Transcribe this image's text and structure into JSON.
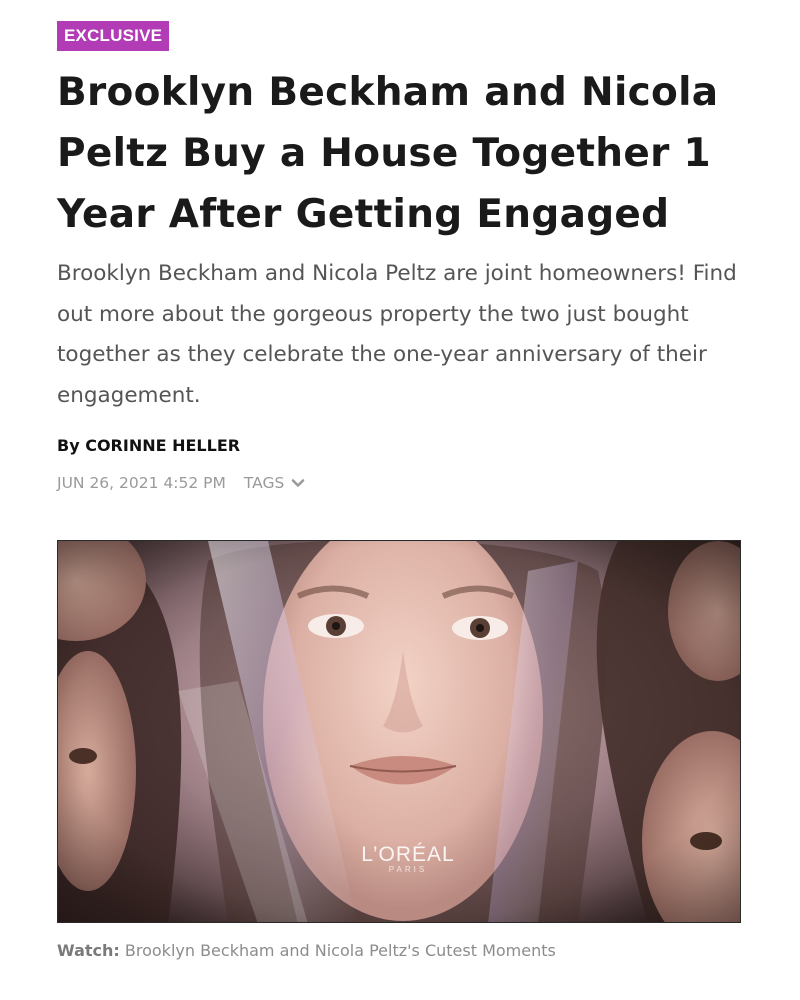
{
  "article": {
    "badge": "EXCLUSIVE",
    "headline": "Brooklyn Beckham and Nicola Peltz Buy a House Together 1 Year After Getting Engaged",
    "dek": "Brooklyn Beckham and Nicola Peltz are joint homeowners! Find out more about the gorgeous property the two just bought together as they celebrate the one-year anniversary of their engagement.",
    "byline_prefix": "By",
    "author": "CORINNE HELLER",
    "date": "JUN 26, 2021 4:52 PM",
    "tags_label": "TAGS"
  },
  "video": {
    "brand_name": "L’ORÉAL",
    "brand_sub": "PARIS",
    "caption_label": "Watch:",
    "caption_text": "Brooklyn Beckham and Nicola Peltz's Cutest Moments"
  },
  "colors": {
    "badge_bg": "#b23bb6",
    "headline": "#1a1a1a",
    "dek": "#555555",
    "meta": "#9a9a9a"
  },
  "icons": {
    "tags_toggle": "chevron-down-icon"
  }
}
